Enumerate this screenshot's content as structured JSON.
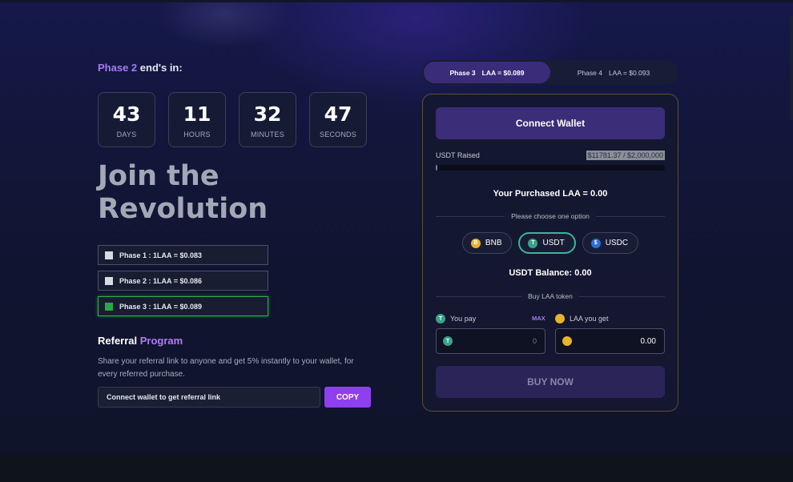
{
  "countdown": {
    "title_prefix": "Phase 2",
    "title_suffix": " end's in:",
    "units": [
      {
        "value": "43",
        "label": "DAYS"
      },
      {
        "value": "11",
        "label": "HOURS"
      },
      {
        "value": "32",
        "label": "MINUTES"
      },
      {
        "value": "47",
        "label": "SECONDS"
      }
    ]
  },
  "headline": {
    "line1": "Join the",
    "line2": "Revolution"
  },
  "phases": [
    {
      "label": "Phase 1 : 1LAA = $0.083",
      "active": false
    },
    {
      "label": "Phase 2 : 1LAA = $0.086",
      "active": false
    },
    {
      "label": "Phase 3 : 1LAA = $0.089",
      "active": true
    }
  ],
  "referral": {
    "title_main": "Referral",
    "title_accent": "Program",
    "description": "Share your referral link to anyone and get 5% instantly to your wallet, for every referred purchase.",
    "input_text": "Connect wallet to get referral link",
    "copy_label": "COPY"
  },
  "tabs": [
    {
      "phase": "Phase 3",
      "price": "LAA = $0.089",
      "active": true
    },
    {
      "phase": "Phase 4",
      "price": "LAA = $0.093",
      "active": false
    }
  ],
  "panel": {
    "connect_label": "Connect Wallet",
    "raised_label": "USDT Raised",
    "raised_value": "$11781.37 / $2,000,000",
    "raised_progress": 0.006,
    "purchased": "Your Purchased LAA = 0.00",
    "choose_label": "Please choose one option",
    "options": [
      {
        "label": "BNB",
        "icon": "bnb-icon",
        "glyph": "B",
        "active": false
      },
      {
        "label": "USDT",
        "icon": "usdt-icon",
        "glyph": "T",
        "active": true
      },
      {
        "label": "USDC",
        "icon": "usdc-icon",
        "glyph": "$",
        "active": false
      }
    ],
    "balance": "USDT Balance: 0.00",
    "buy_section_label": "Buy LAA token",
    "pay_label": "You pay",
    "max_label": "MAX",
    "get_label": "LAA you get",
    "pay_value": "0",
    "get_value": "0.00",
    "buy_label": "BUY NOW"
  },
  "colors": {
    "accent_purple": "#a77bf3",
    "copy_button": "#8e3ff0",
    "active_phase_green": "#27a844",
    "usdt_teal": "#3aa38a",
    "bnb_gold": "#e9b32a",
    "usdc_blue": "#2a6fd6"
  }
}
